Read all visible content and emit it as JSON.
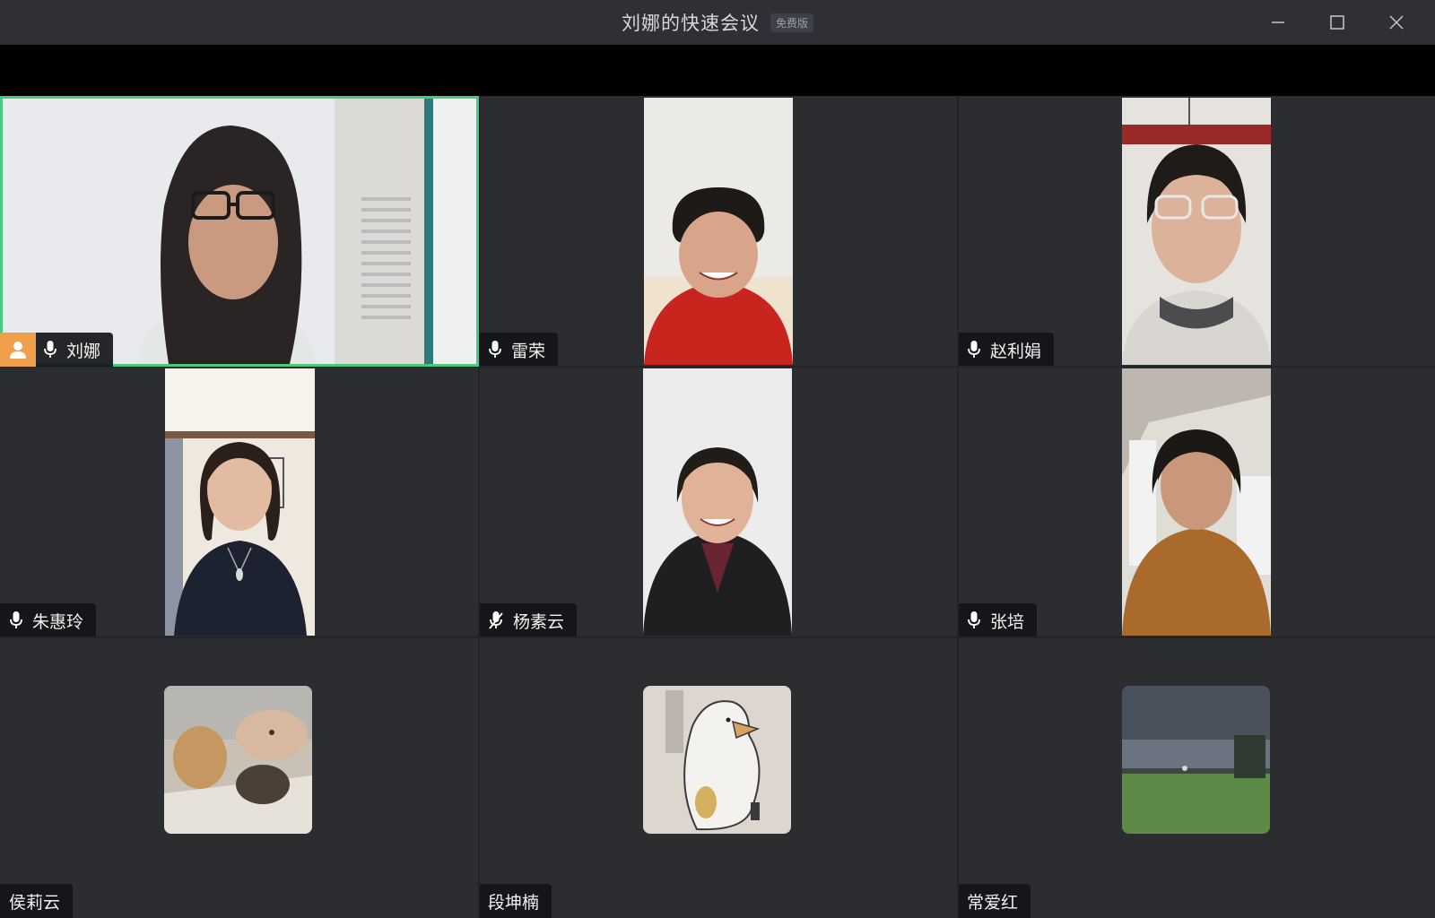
{
  "window": {
    "title": "刘娜的快速会议",
    "badge": "免费版"
  },
  "participants": [
    {
      "name": "刘娜",
      "mic": "on",
      "host": true
    },
    {
      "name": "雷荣",
      "mic": "on"
    },
    {
      "name": "赵利娟",
      "mic": "on"
    },
    {
      "name": "朱惠玲",
      "mic": "on"
    },
    {
      "name": "杨素云",
      "mic": "muted"
    },
    {
      "name": "张培",
      "mic": "on"
    },
    {
      "name": "侯莉云",
      "mic": "none"
    },
    {
      "name": "段坤楠",
      "mic": "none"
    },
    {
      "name": "常爱红",
      "mic": "none"
    }
  ],
  "colors": {
    "active_speaker_border": "#4ac97a",
    "host_badge": "#f0a04b",
    "background": "#2b2d31"
  }
}
